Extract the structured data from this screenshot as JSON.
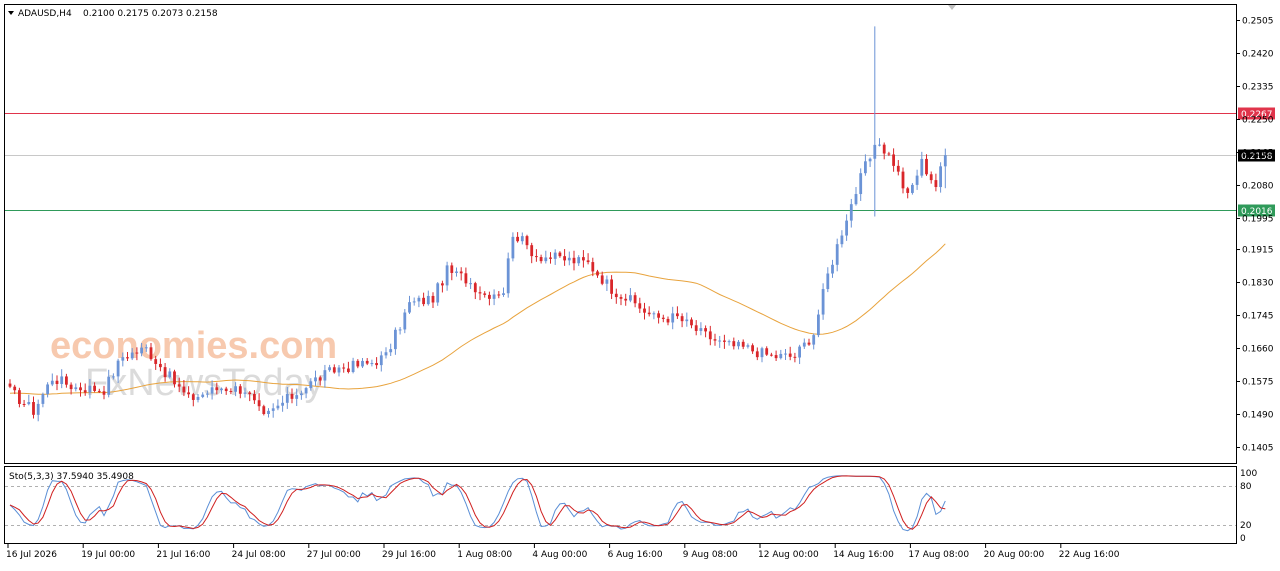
{
  "header": {
    "symbol": "ADAUSD,H4",
    "ohlc": "0.2100 0.2175 0.2073 0.2158"
  },
  "watermark": {
    "line1": "economies.com",
    "line2": "FxNewsToday"
  },
  "colors": {
    "bull": "#6b93d6",
    "bear": "#d9262a",
    "ma": "#e8a33d",
    "resistance": "#e0344b",
    "support": "#2f9a5a",
    "bid": "#000000",
    "stoch_main": "#5b8fd6",
    "stoch_signal": "#d02020"
  },
  "chart_data": [
    {
      "type": "candlestick",
      "title": "ADAUSD,H4",
      "y_ticks": [
        "0.2505",
        "0.2420",
        "0.2335",
        "0.2250",
        "0.2165",
        "0.2080",
        "0.1995",
        "0.1915",
        "0.1830",
        "0.1745",
        "0.1660",
        "0.1575",
        "0.1490",
        "0.1405"
      ],
      "ylim": [
        0.1405,
        0.2505
      ],
      "x_ticks": [
        "16 Jul 2026",
        "19 Jul 00:00",
        "21 Jul 16:00",
        "24 Jul 08:00",
        "27 Jul 00:00",
        "29 Jul 16:00",
        "1 Aug 08:00",
        "4 Aug 00:00",
        "6 Aug 16:00",
        "9 Aug 08:00",
        "12 Aug 00:00",
        "14 Aug 16:00",
        "17 Aug 08:00",
        "20 Aug 00:00",
        "22 Aug 16:00"
      ],
      "levels": [
        {
          "name": "resistance",
          "value": 0.2267,
          "label": "0.2267"
        },
        {
          "name": "current",
          "value": 0.2158,
          "label": "0.2158"
        },
        {
          "name": "support",
          "value": 0.2016,
          "label": "0.2016"
        }
      ],
      "anchors": [
        {
          "bar": 0,
          "close": 0.155
        },
        {
          "bar": 5,
          "close": 0.15
        },
        {
          "bar": 9,
          "close": 0.1585
        },
        {
          "bar": 14,
          "close": 0.156
        },
        {
          "bar": 20,
          "close": 0.1555
        },
        {
          "bar": 24,
          "close": 0.164
        },
        {
          "bar": 29,
          "close": 0.166
        },
        {
          "bar": 33,
          "close": 0.16
        },
        {
          "bar": 38,
          "close": 0.153
        },
        {
          "bar": 45,
          "close": 0.156
        },
        {
          "bar": 50,
          "close": 0.1555
        },
        {
          "bar": 54,
          "close": 0.148
        },
        {
          "bar": 58,
          "close": 0.152
        },
        {
          "bar": 65,
          "close": 0.158
        },
        {
          "bar": 70,
          "close": 0.161
        },
        {
          "bar": 76,
          "close": 0.162
        },
        {
          "bar": 80,
          "close": 0.164
        },
        {
          "bar": 85,
          "close": 0.1775
        },
        {
          "bar": 90,
          "close": 0.179
        },
        {
          "bar": 93,
          "close": 0.186
        },
        {
          "bar": 97,
          "close": 0.184
        },
        {
          "bar": 101,
          "close": 0.18
        },
        {
          "bar": 105,
          "close": 0.181
        },
        {
          "bar": 107,
          "close": 0.196
        },
        {
          "bar": 112,
          "close": 0.19
        },
        {
          "bar": 118,
          "close": 0.189
        },
        {
          "bar": 123,
          "close": 0.188
        },
        {
          "bar": 128,
          "close": 0.1815
        },
        {
          "bar": 133,
          "close": 0.1775
        },
        {
          "bar": 137,
          "close": 0.174
        },
        {
          "bar": 142,
          "close": 0.174
        },
        {
          "bar": 147,
          "close": 0.17
        },
        {
          "bar": 152,
          "close": 0.167
        },
        {
          "bar": 157,
          "close": 0.166
        },
        {
          "bar": 162,
          "close": 0.164
        },
        {
          "bar": 167,
          "close": 0.164
        },
        {
          "bar": 171,
          "close": 0.17
        },
        {
          "bar": 174,
          "close": 0.185
        },
        {
          "bar": 178,
          "close": 0.2
        },
        {
          "bar": 182,
          "close": 0.213
        },
        {
          "bar": 185,
          "close": 0.219
        },
        {
          "bar": 188,
          "close": 0.214
        },
        {
          "bar": 191,
          "close": 0.205
        },
        {
          "bar": 194,
          "close": 0.214
        },
        {
          "bar": 197,
          "close": 0.208
        },
        {
          "bar": 199,
          "close": 0.2158
        }
      ],
      "spike": {
        "bar": 184,
        "high": 0.249,
        "low": 0.2
      },
      "ma": {
        "period": "long",
        "start": 0.1545,
        "end": 0.188
      }
    },
    {
      "type": "line",
      "title": "Sto(5,3,3) 37.5940 35.4908",
      "y_ticks": [
        "100",
        "80",
        "20",
        "0"
      ],
      "ylim": [
        0,
        100
      ],
      "series": [
        {
          "name": "Main",
          "values": []
        },
        {
          "name": "Signal",
          "values": []
        }
      ]
    }
  ]
}
